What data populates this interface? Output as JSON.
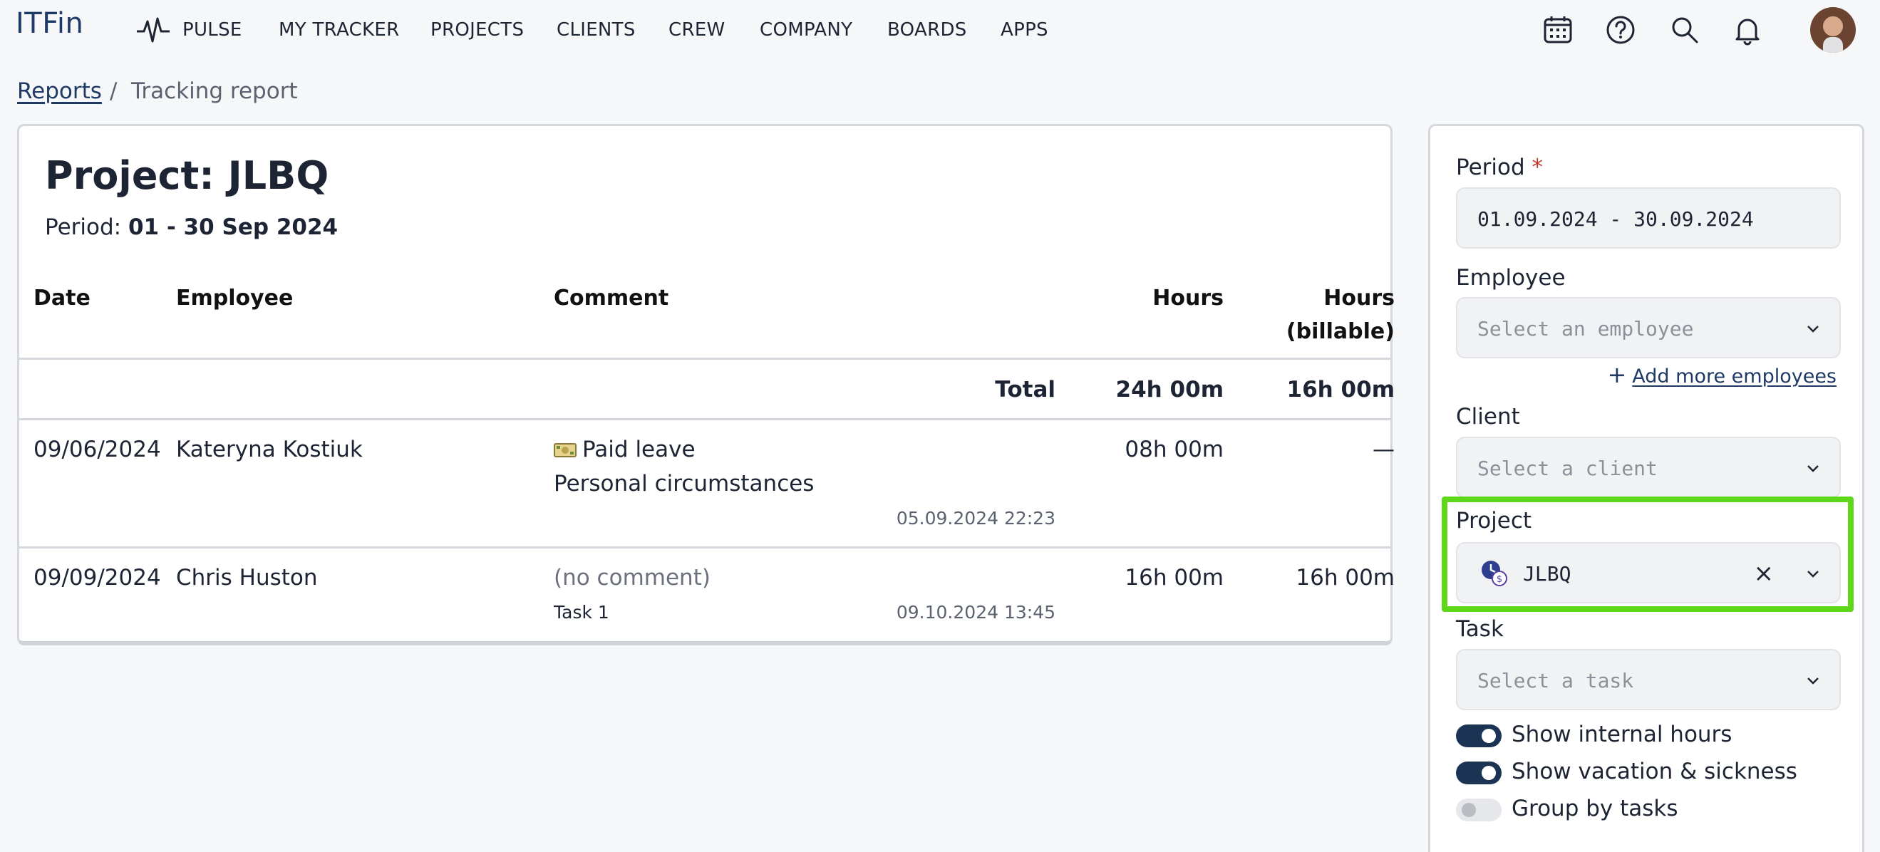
{
  "nav": {
    "logo": "ITFin",
    "items": [
      "PULSE",
      "MY TRACKER",
      "PROJECTS",
      "CLIENTS",
      "CREW",
      "COMPANY",
      "BOARDS",
      "APPS"
    ],
    "icons": [
      "calendar-icon",
      "help-icon",
      "search-icon",
      "bell-icon"
    ]
  },
  "breadcrumb": {
    "parent": "Reports",
    "separator": "/",
    "current": "Tracking report"
  },
  "report": {
    "title": "Project: JLBQ",
    "period_label": "Period: ",
    "period_value": "01 - 30 Sep 2024",
    "columns": {
      "date": "Date",
      "employee": "Employee",
      "comment": "Comment",
      "hours": "Hours",
      "billable_line1": "Hours",
      "billable_line2": "(billable)"
    },
    "total": {
      "label": "Total",
      "hours": "24h 00m",
      "billable": "16h 00m"
    },
    "rows": [
      {
        "date": "09/06/2024",
        "employee": "Kateryna Kostiuk",
        "comment_type": "Paid leave",
        "comment": "Personal circumstances",
        "timestamp": "05.09.2024 22:23",
        "hours": "08h 00m",
        "billable": "—"
      },
      {
        "date": "09/09/2024",
        "employee": "Chris Huston",
        "comment": "(no comment)",
        "task": "Task 1",
        "timestamp": "09.10.2024 13:45",
        "hours": "16h 00m",
        "billable": "16h 00m"
      }
    ]
  },
  "filters": {
    "period": {
      "label": "Period",
      "required_mark": "*",
      "value": "01.09.2024 - 30.09.2024"
    },
    "employee": {
      "label": "Employee",
      "placeholder": "Select an employee",
      "add_more": "Add more employees"
    },
    "client": {
      "label": "Client",
      "placeholder": "Select a client"
    },
    "project": {
      "label": "Project",
      "value": "JLBQ"
    },
    "task": {
      "label": "Task",
      "placeholder": "Select a task"
    },
    "toggles": [
      {
        "label": "Show internal hours",
        "on": true
      },
      {
        "label": "Show vacation & sickness",
        "on": true
      },
      {
        "label": "Group by tasks",
        "on": false
      }
    ]
  },
  "colors": {
    "brand": "#1f3a66",
    "highlight": "#5fd61a",
    "toggle_on": "#1c3454"
  }
}
